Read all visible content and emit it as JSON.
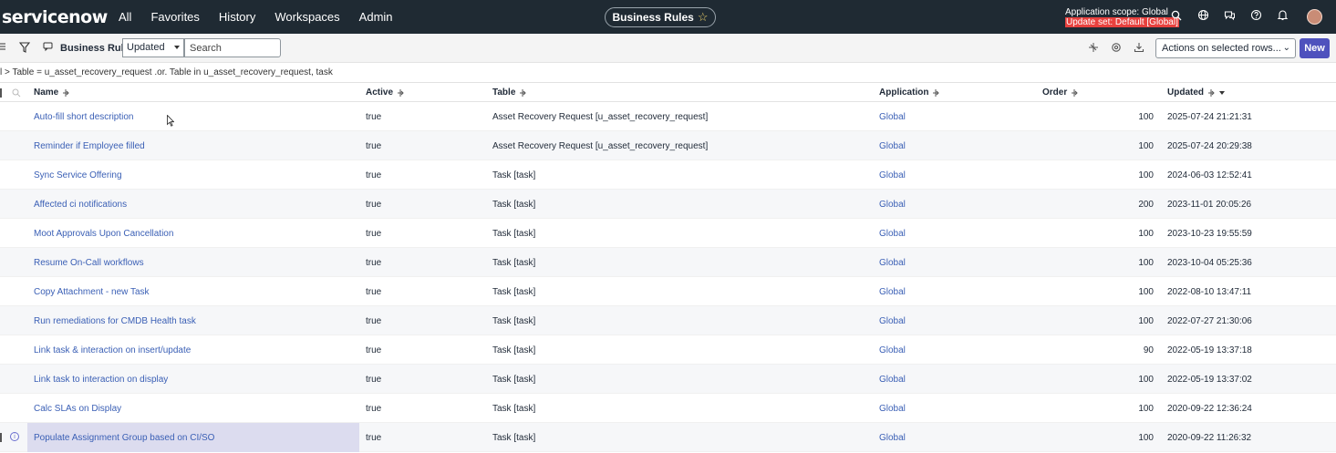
{
  "app": {
    "logo": "servicenow",
    "nav": [
      "All",
      "Favorites",
      "History",
      "Workspaces",
      "Admin"
    ],
    "context_pill": "Business Rules",
    "scope_line1": "Application scope: Global",
    "scope_line2": "Update set: Default [Global]",
    "icons": [
      "search-icon",
      "globe-icon",
      "chat-icon",
      "help-icon",
      "bell-icon",
      "avatar"
    ]
  },
  "toolbar": {
    "title": "Business Rules",
    "search_field_value": "Updated",
    "search_placeholder": "Search",
    "actions_select": "Actions on selected rows...",
    "new_label": "New"
  },
  "breadcrumb": "l > Table = u_asset_recovery_request .or. Table in u_asset_recovery_request, task",
  "columns": {
    "name": "Name",
    "active": "Active",
    "table": "Table",
    "application": "Application",
    "order": "Order",
    "updated": "Updated"
  },
  "rows": [
    {
      "name": "Auto-fill short description",
      "active": "true",
      "table": "Asset Recovery Request [u_asset_recovery_request]",
      "application": "Global",
      "order": "100",
      "updated": "2025-07-24 21:21:31"
    },
    {
      "name": "Reminder if Employee filled",
      "active": "true",
      "table": "Asset Recovery Request [u_asset_recovery_request]",
      "application": "Global",
      "order": "100",
      "updated": "2025-07-24 20:29:38"
    },
    {
      "name": "Sync Service Offering",
      "active": "true",
      "table": "Task [task]",
      "application": "Global",
      "order": "100",
      "updated": "2024-06-03 12:52:41"
    },
    {
      "name": "Affected ci notifications",
      "active": "true",
      "table": "Task [task]",
      "application": "Global",
      "order": "200",
      "updated": "2023-11-01 20:05:26"
    },
    {
      "name": "Moot Approvals Upon Cancellation",
      "active": "true",
      "table": "Task [task]",
      "application": "Global",
      "order": "100",
      "updated": "2023-10-23 19:55:59"
    },
    {
      "name": "Resume On-Call workflows",
      "active": "true",
      "table": "Task [task]",
      "application": "Global",
      "order": "100",
      "updated": "2023-10-04 05:25:36"
    },
    {
      "name": "Copy Attachment - new Task",
      "active": "true",
      "table": "Task [task]",
      "application": "Global",
      "order": "100",
      "updated": "2022-08-10 13:47:11"
    },
    {
      "name": "Run remediations for CMDB Health task",
      "active": "true",
      "table": "Task [task]",
      "application": "Global",
      "order": "100",
      "updated": "2022-07-27 21:30:06"
    },
    {
      "name": "Link task & interaction on insert/update",
      "active": "true",
      "table": "Task [task]",
      "application": "Global",
      "order": "90",
      "updated": "2022-05-19 13:37:18"
    },
    {
      "name": "Link task to interaction on display",
      "active": "true",
      "table": "Task [task]",
      "application": "Global",
      "order": "100",
      "updated": "2022-05-19 13:37:02"
    },
    {
      "name": "Calc SLAs on Display",
      "active": "true",
      "table": "Task [task]",
      "application": "Global",
      "order": "100",
      "updated": "2020-09-22 12:36:24"
    },
    {
      "name": "Populate Assignment Group based on CI/SO",
      "active": "true",
      "table": "Task [task]",
      "application": "Global",
      "order": "100",
      "updated": "2020-09-22 11:26:32"
    }
  ],
  "colors": {
    "nav_bg": "#1f2a33",
    "link": "#3a5fb5",
    "primary": "#4f52bd",
    "update_set_bg": "#e8413e"
  }
}
